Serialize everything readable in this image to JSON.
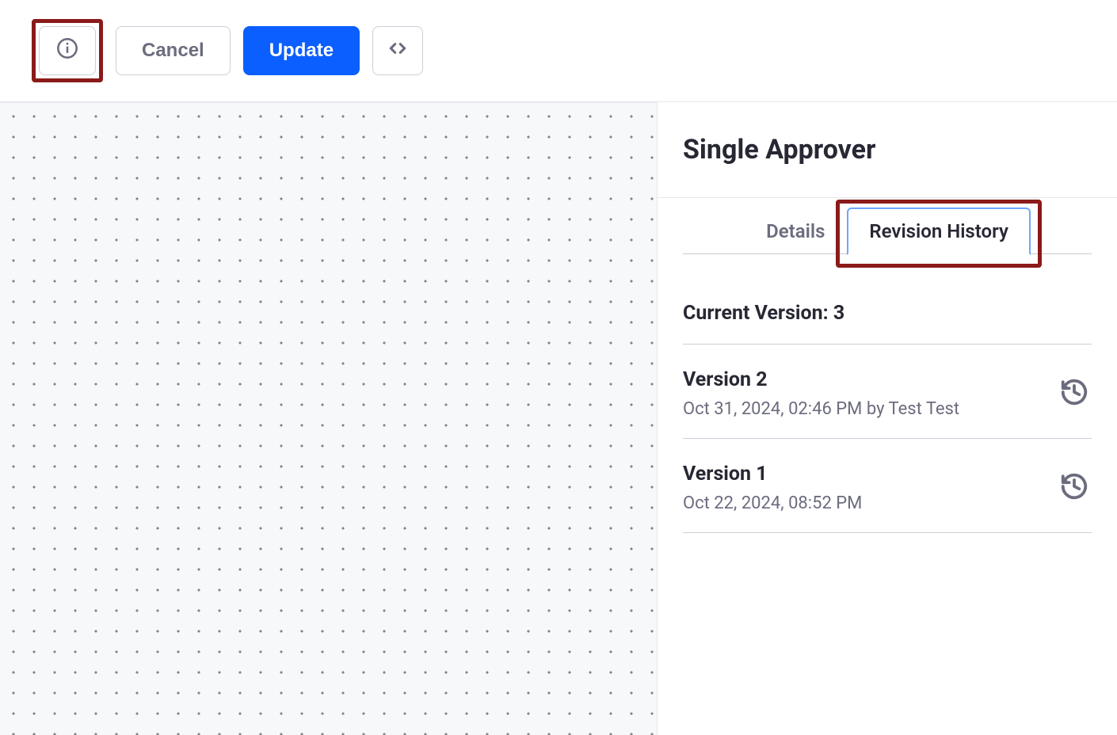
{
  "toolbar": {
    "cancel_label": "Cancel",
    "update_label": "Update"
  },
  "panel": {
    "title": "Single Approver",
    "tabs": {
      "details": "Details",
      "revision_history": "Revision History"
    },
    "current_version_label": "Current Version: 3",
    "versions": [
      {
        "title": "Version 2",
        "meta": "Oct 31, 2024, 02:46 PM by Test Test"
      },
      {
        "title": "Version 1",
        "meta": "Oct 22, 2024, 08:52 PM"
      }
    ]
  }
}
